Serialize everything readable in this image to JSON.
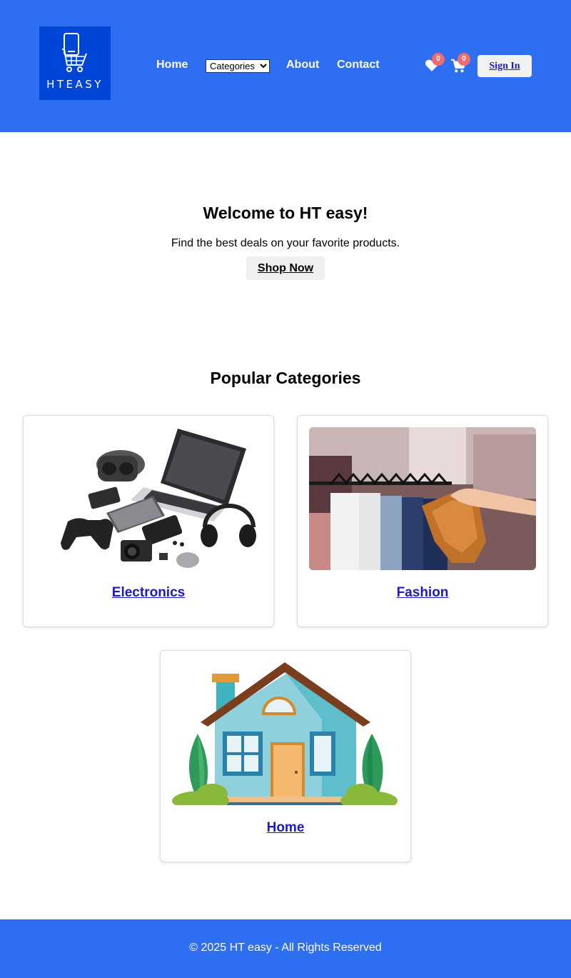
{
  "brand": {
    "logo_text": "HTEASY"
  },
  "nav": {
    "home": "Home",
    "categories_selected": "Categories",
    "about": "About",
    "contact": "Contact"
  },
  "header": {
    "wishlist_count": "0",
    "cart_count": "0",
    "signin_label": "Sign In"
  },
  "hero": {
    "title": "Welcome to HT easy!",
    "subtitle": "Find the best deals on your favorite products.",
    "cta_label": "Shop Now"
  },
  "categories": {
    "title": "Popular Categories",
    "items": [
      {
        "label": "Electronics"
      },
      {
        "label": "Fashion"
      },
      {
        "label": "Home"
      }
    ]
  },
  "footer": {
    "text": "© 2025 HT easy - All Rights Reserved"
  },
  "colors": {
    "header_bg": "#2e6ef0",
    "logo_bg": "#0046d6",
    "badge": "#f06b6b",
    "link": "#1a1acc"
  },
  "icons": [
    "cart-logo-icon",
    "heart-icon",
    "cart-icon"
  ]
}
